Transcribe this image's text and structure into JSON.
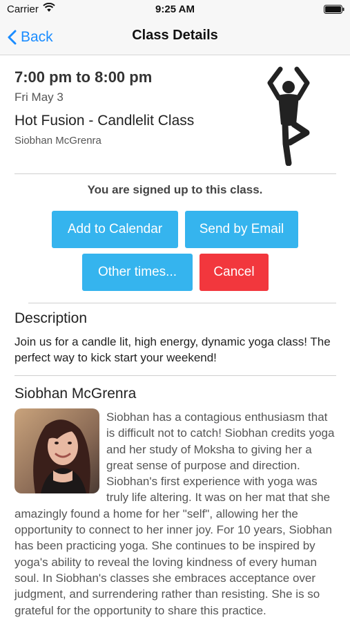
{
  "status_bar": {
    "carrier": "Carrier",
    "time": "9:25 AM"
  },
  "nav": {
    "back_label": "Back",
    "title": "Class Details"
  },
  "class": {
    "time_range": "7:00 pm to 8:00 pm",
    "date": "Fri May 3",
    "name": "Hot Fusion - Candlelit Class",
    "teacher": "Siobhan McGrenra",
    "status_message": "You are signed up to this class."
  },
  "actions": {
    "add_to_calendar": "Add to Calendar",
    "send_by_email": "Send by Email",
    "other_times": "Other times...",
    "cancel": "Cancel"
  },
  "description": {
    "heading": "Description",
    "text": "Join us for a candle lit, high energy, dynamic yoga class! The perfect way to kick start your weekend!"
  },
  "instructor": {
    "name": "Siobhan McGrenra",
    "bio": "Siobhan has a contagious enthusiasm that is difficult not to catch! Siobhan credits yoga and her study of Moksha to giving her a great sense of purpose and direction. Siobhan's first experience with yoga was truly life altering. It was on her mat that she amazingly found a home for her \"self\", allowing her the opportunity to connect to her inner joy. For 10 years, Siobhan has been practicing yoga. She continues to be inspired by yoga's ability to reveal the loving kindness of every human soul. In Siobhan's classes she embraces acceptance over judgment, and surrendering rather than resisting. She is so grateful for the opportunity to share this practice."
  },
  "icons": {
    "back": "chevron-left-icon",
    "class_type": "yoga-tree-pose-icon",
    "wifi": "wifi-icon",
    "battery": "battery-icon"
  },
  "colors": {
    "accent_blue": "#35b4ee",
    "link_blue": "#1a8cff",
    "cancel_red": "#f2373d"
  }
}
